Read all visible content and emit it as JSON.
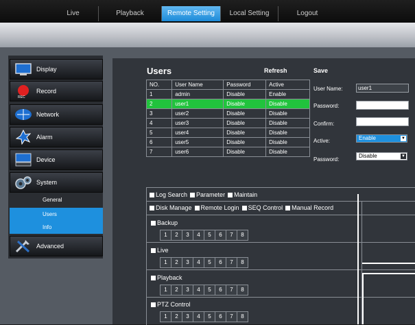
{
  "nav": {
    "tabs": [
      "Live",
      "Playback",
      "Remote Setting",
      "Local Setting",
      "Logout"
    ],
    "active_index": 2
  },
  "sidebar": {
    "buttons": [
      {
        "label": "Display",
        "icon": "monitor-icon"
      },
      {
        "label": "Record",
        "icon": "record-icon"
      },
      {
        "label": "Network",
        "icon": "network-icon"
      },
      {
        "label": "Alarm",
        "icon": "alarm-icon"
      },
      {
        "label": "Device",
        "icon": "device-icon"
      },
      {
        "label": "System",
        "icon": "system-icon"
      }
    ],
    "system_subitems": [
      "General",
      "Users",
      "Info"
    ],
    "active_subitems": [
      "Users",
      "Info"
    ],
    "advanced": {
      "label": "Advanced",
      "icon": "advanced-icon"
    }
  },
  "users": {
    "title": "Users",
    "refresh_label": "Refresh",
    "save_label": "Save",
    "columns": [
      "NO.",
      "User Name",
      "Password",
      "Active"
    ],
    "rows": [
      [
        "1",
        "admin",
        "Disable",
        "Enable"
      ],
      [
        "2",
        "user1",
        "Disable",
        "Disable"
      ],
      [
        "3",
        "user2",
        "Disable",
        "Disable"
      ],
      [
        "4",
        "user3",
        "Disable",
        "Disable"
      ],
      [
        "5",
        "user4",
        "Disable",
        "Disable"
      ],
      [
        "6",
        "user5",
        "Disable",
        "Disable"
      ],
      [
        "7",
        "user6",
        "Disable",
        "Disable"
      ]
    ],
    "selected_row": 1
  },
  "form": {
    "user_name_label": "User Name:",
    "user_name_value": "user1",
    "password_label": "Password:",
    "password_value": "",
    "confirm_label": "Confirm:",
    "confirm_value": "",
    "active_label": "Active:",
    "active_value": "Enable",
    "password_select_label": "Password:",
    "password_select_value": "Disable"
  },
  "permissions": {
    "row1": [
      "Log Search",
      "Parameter",
      "Maintain"
    ],
    "row2": [
      "Disk Manage",
      "Remote Login",
      "SEQ Control",
      "Manual Record"
    ],
    "groups": [
      "Backup",
      "Live",
      "Playback",
      "PTZ Control"
    ],
    "channels": [
      "1",
      "2",
      "3",
      "4",
      "5",
      "6",
      "7",
      "8"
    ]
  },
  "colors": {
    "accent": "#1c8ad8",
    "selected_row": "#21c33d",
    "sidebar_active": "#1e90de"
  }
}
